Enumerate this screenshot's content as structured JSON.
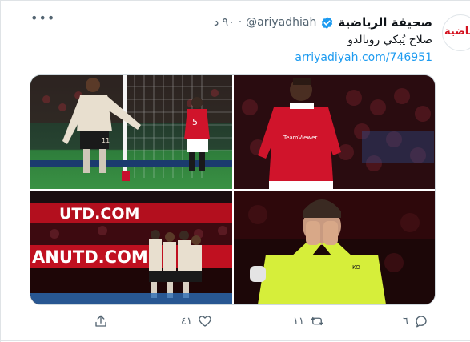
{
  "tweet": {
    "display_name": "صحيفة الرياضية",
    "handle": "@ariyadhiah",
    "separator": "·",
    "time": "٩٠ د",
    "text": "صلاح يُبكي رونالدو",
    "link": "arriyadiyah.com/746951",
    "avatar_text": "الرياضية"
  },
  "actions": {
    "reply_count": "٦",
    "retweet_count": "١١",
    "like_count": "٤١",
    "share_count": ""
  },
  "media": {
    "banner_text_1": "UTD.COM",
    "banner_text_2": "ANUTD.COM",
    "shirt_number_1": "11",
    "shirt_number_2": "5",
    "sponsor": "TeamViewer"
  },
  "colors": {
    "accent": "#1d9bf0",
    "muted": "#536471",
    "liverpool_kit": "#e8dfcf",
    "united_red": "#d0142b",
    "keeper_kit": "#d6ee3a"
  }
}
